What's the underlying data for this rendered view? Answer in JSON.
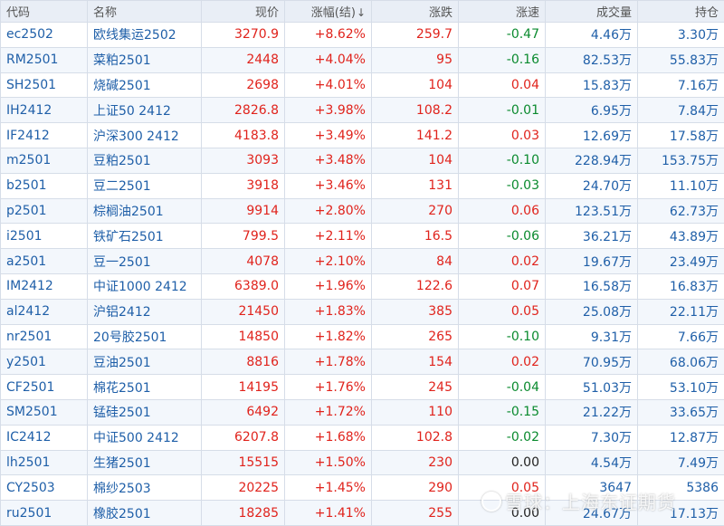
{
  "headers": {
    "code": "代码",
    "name": "名称",
    "price": "现价",
    "change_pct": "涨幅(结)",
    "sort_arrow": "↓",
    "change": "涨跌",
    "speed": "涨速",
    "volume": "成交量",
    "open_interest": "持仓"
  },
  "rows": [
    {
      "code": "ec2502",
      "name": "欧线集运2502",
      "price": "3270.9",
      "change_pct": "+8.62%",
      "change": "259.7",
      "speed": "-0.47",
      "volume": "4.46万",
      "open_interest": "3.30万"
    },
    {
      "code": "RM2501",
      "name": "菜粕2501",
      "price": "2448",
      "change_pct": "+4.04%",
      "change": "95",
      "speed": "-0.16",
      "volume": "82.53万",
      "open_interest": "55.83万"
    },
    {
      "code": "SH2501",
      "name": "烧碱2501",
      "price": "2698",
      "change_pct": "+4.01%",
      "change": "104",
      "speed": "0.04",
      "volume": "15.83万",
      "open_interest": "7.16万"
    },
    {
      "code": "IH2412",
      "name": "上证50 2412",
      "price": "2826.8",
      "change_pct": "+3.98%",
      "change": "108.2",
      "speed": "-0.01",
      "volume": "6.95万",
      "open_interest": "7.84万"
    },
    {
      "code": "IF2412",
      "name": "沪深300 2412",
      "price": "4183.8",
      "change_pct": "+3.49%",
      "change": "141.2",
      "speed": "0.03",
      "volume": "12.69万",
      "open_interest": "17.58万"
    },
    {
      "code": "m2501",
      "name": "豆粕2501",
      "price": "3093",
      "change_pct": "+3.48%",
      "change": "104",
      "speed": "-0.10",
      "volume": "228.94万",
      "open_interest": "153.75万"
    },
    {
      "code": "b2501",
      "name": "豆二2501",
      "price": "3918",
      "change_pct": "+3.46%",
      "change": "131",
      "speed": "-0.03",
      "volume": "24.70万",
      "open_interest": "11.10万"
    },
    {
      "code": "p2501",
      "name": "棕榈油2501",
      "price": "9914",
      "change_pct": "+2.80%",
      "change": "270",
      "speed": "0.06",
      "volume": "123.51万",
      "open_interest": "62.73万"
    },
    {
      "code": "i2501",
      "name": "铁矿石2501",
      "price": "799.5",
      "change_pct": "+2.11%",
      "change": "16.5",
      "speed": "-0.06",
      "volume": "36.21万",
      "open_interest": "43.89万"
    },
    {
      "code": "a2501",
      "name": "豆一2501",
      "price": "4078",
      "change_pct": "+2.10%",
      "change": "84",
      "speed": "0.02",
      "volume": "19.67万",
      "open_interest": "23.49万"
    },
    {
      "code": "IM2412",
      "name": "中证1000 2412",
      "price": "6389.0",
      "change_pct": "+1.96%",
      "change": "122.6",
      "speed": "0.07",
      "volume": "16.58万",
      "open_interest": "16.83万"
    },
    {
      "code": "al2412",
      "name": "沪铝2412",
      "price": "21450",
      "change_pct": "+1.83%",
      "change": "385",
      "speed": "0.05",
      "volume": "25.08万",
      "open_interest": "22.11万"
    },
    {
      "code": "nr2501",
      "name": "20号胶2501",
      "price": "14850",
      "change_pct": "+1.82%",
      "change": "265",
      "speed": "-0.10",
      "volume": "9.31万",
      "open_interest": "7.66万"
    },
    {
      "code": "y2501",
      "name": "豆油2501",
      "price": "8816",
      "change_pct": "+1.78%",
      "change": "154",
      "speed": "0.02",
      "volume": "70.95万",
      "open_interest": "68.06万"
    },
    {
      "code": "CF2501",
      "name": "棉花2501",
      "price": "14195",
      "change_pct": "+1.76%",
      "change": "245",
      "speed": "-0.04",
      "volume": "51.03万",
      "open_interest": "53.10万"
    },
    {
      "code": "SM2501",
      "name": "锰硅2501",
      "price": "6492",
      "change_pct": "+1.72%",
      "change": "110",
      "speed": "-0.15",
      "volume": "21.22万",
      "open_interest": "33.65万"
    },
    {
      "code": "IC2412",
      "name": "中证500 2412",
      "price": "6207.8",
      "change_pct": "+1.68%",
      "change": "102.8",
      "speed": "-0.02",
      "volume": "7.30万",
      "open_interest": "12.87万"
    },
    {
      "code": "lh2501",
      "name": "生猪2501",
      "price": "15515",
      "change_pct": "+1.50%",
      "change": "230",
      "speed": "0.00",
      "volume": "4.54万",
      "open_interest": "7.49万"
    },
    {
      "code": "CY2503",
      "name": "棉纱2503",
      "price": "20225",
      "change_pct": "+1.45%",
      "change": "290",
      "speed": "0.05",
      "volume": "3647",
      "open_interest": "5386"
    },
    {
      "code": "ru2501",
      "name": "橡胶2501",
      "price": "18285",
      "change_pct": "+1.41%",
      "change": "255",
      "speed": "0.00",
      "volume": "24.67万",
      "open_interest": "17.13万"
    }
  ],
  "watermark": "雪球：上海东证期货",
  "colors": {
    "up": "#e0231c",
    "down": "#0a8a2e",
    "flat": "#222222",
    "code": "#1f5fa8",
    "header_bg": "#e9eef6"
  }
}
